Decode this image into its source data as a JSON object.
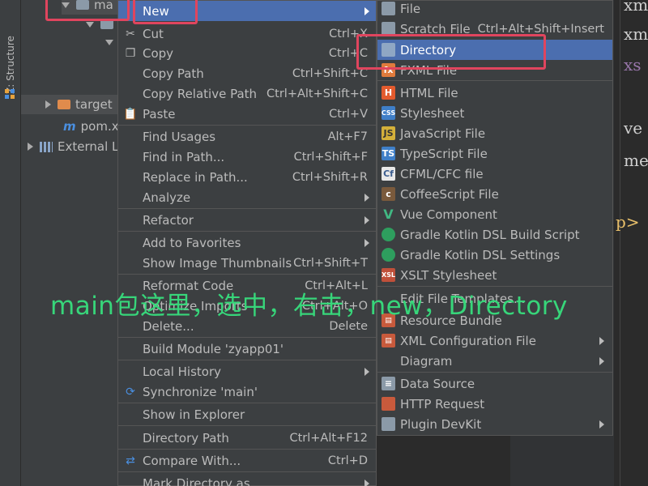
{
  "tool_strip": {
    "structure_tab": "Z: Structure"
  },
  "tree": {
    "rows": [
      {
        "label": "ma"
      },
      {
        "label": ""
      },
      {
        "label": ""
      },
      {
        "label": "target"
      },
      {
        "label": "pom.x"
      },
      {
        "label": "External L"
      }
    ]
  },
  "editor": {
    "lines": [
      "xm",
      "xm",
      "xs",
      "ve",
      "me",
      "p>"
    ]
  },
  "context_menu": {
    "items": [
      {
        "label": "New",
        "shortcut": ""
      },
      {
        "label": "Cut",
        "shortcut": "Ctrl+X"
      },
      {
        "label": "Copy",
        "shortcut": "Ctrl+C"
      },
      {
        "label": "Copy Path",
        "shortcut": "Ctrl+Shift+C"
      },
      {
        "label": "Copy Relative Path",
        "shortcut": "Ctrl+Alt+Shift+C"
      },
      {
        "label": "Paste",
        "shortcut": "Ctrl+V"
      },
      {
        "label": "Find Usages",
        "shortcut": "Alt+F7"
      },
      {
        "label": "Find in Path...",
        "shortcut": "Ctrl+Shift+F"
      },
      {
        "label": "Replace in Path...",
        "shortcut": "Ctrl+Shift+R"
      },
      {
        "label": "Analyze",
        "shortcut": ""
      },
      {
        "label": "Refactor",
        "shortcut": ""
      },
      {
        "label": "Add to Favorites",
        "shortcut": ""
      },
      {
        "label": "Show Image Thumbnails",
        "shortcut": "Ctrl+Shift+T"
      },
      {
        "label": "Reformat Code",
        "shortcut": "Ctrl+Alt+L"
      },
      {
        "label": "Optimize Imports",
        "shortcut": "Ctrl+Alt+O"
      },
      {
        "label": "Delete...",
        "shortcut": "Delete"
      },
      {
        "label": "Build Module 'zyapp01'",
        "shortcut": ""
      },
      {
        "label": "Local History",
        "shortcut": ""
      },
      {
        "label": "Synchronize 'main'",
        "shortcut": ""
      },
      {
        "label": "Show in Explorer",
        "shortcut": ""
      },
      {
        "label": "Directory Path",
        "shortcut": "Ctrl+Alt+F12"
      },
      {
        "label": "Compare With...",
        "shortcut": "Ctrl+D"
      },
      {
        "label": "Mark Directory as",
        "shortcut": ""
      }
    ]
  },
  "new_submenu": {
    "items": [
      {
        "label": "File",
        "shortcut": ""
      },
      {
        "label": "Scratch File",
        "shortcut": "Ctrl+Alt+Shift+Insert"
      },
      {
        "label": "Directory",
        "shortcut": ""
      },
      {
        "label": "FXML File",
        "shortcut": ""
      },
      {
        "label": "HTML File",
        "shortcut": ""
      },
      {
        "label": "Stylesheet",
        "shortcut": ""
      },
      {
        "label": "JavaScript File",
        "shortcut": ""
      },
      {
        "label": "TypeScript File",
        "shortcut": ""
      },
      {
        "label": "CFML/CFC file",
        "shortcut": ""
      },
      {
        "label": "CoffeeScript File",
        "shortcut": ""
      },
      {
        "label": "Vue Component",
        "shortcut": ""
      },
      {
        "label": "Gradle Kotlin DSL Build Script",
        "shortcut": ""
      },
      {
        "label": "Gradle Kotlin DSL Settings",
        "shortcut": ""
      },
      {
        "label": "XSLT Stylesheet",
        "shortcut": ""
      },
      {
        "label": "Edit File Templates...",
        "shortcut": ""
      },
      {
        "label": "Resource Bundle",
        "shortcut": ""
      },
      {
        "label": "XML Configuration File",
        "shortcut": ""
      },
      {
        "label": "Diagram",
        "shortcut": ""
      },
      {
        "label": "Data Source",
        "shortcut": ""
      },
      {
        "label": "HTTP Request",
        "shortcut": ""
      },
      {
        "label": "Plugin DevKit",
        "shortcut": ""
      }
    ]
  },
  "annotation": "main包这里，选中，右击，new，Directory",
  "colors": {
    "menu_bg": "#3c3f41",
    "highlight": "#4b6eaf",
    "annotation": "#37d67a",
    "callout": "#e0455e"
  }
}
